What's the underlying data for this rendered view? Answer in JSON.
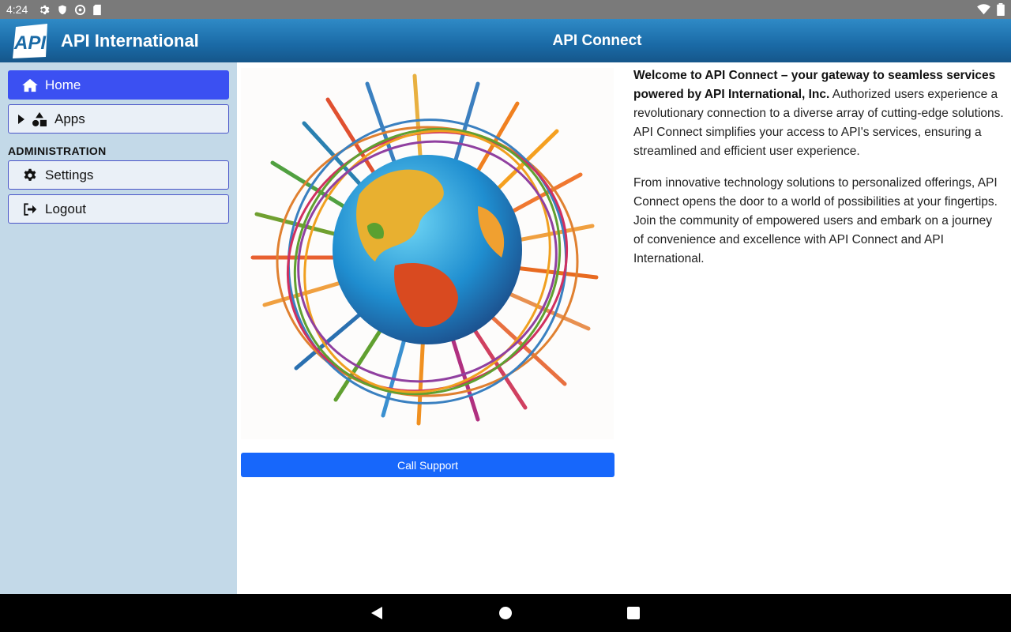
{
  "status_bar": {
    "time": "4:24",
    "left_icons": [
      "gear-icon",
      "shield-icon",
      "sync-icon",
      "sd-card-icon"
    ],
    "right_icons": [
      "wifi-icon",
      "battery-icon"
    ]
  },
  "header": {
    "logo_text": "API",
    "brand": "API International",
    "title": "API Connect",
    "gradient_colors": [
      "#2f8ac6",
      "#15568a"
    ]
  },
  "sidebar": {
    "items": [
      {
        "label": "Home",
        "icon": "home-icon",
        "active": true
      },
      {
        "label": "Apps",
        "icon": "shapes-icon",
        "expandable": true
      }
    ],
    "section_label": "ADMINISTRATION",
    "admin_items": [
      {
        "label": "Settings",
        "icon": "gear-icon"
      },
      {
        "label": "Logout",
        "icon": "logout-icon"
      }
    ],
    "active_color": "#3b50f2",
    "background": "#c3d9e8"
  },
  "main": {
    "illustration": "globe-cables-illustration",
    "call_support_label": "Call Support",
    "call_support_color": "#1767fb",
    "intro_bold": "Welcome to API Connect – your gateway to seamless services powered by API International, Inc.",
    "intro_rest": " Authorized users experience a revolutionary connection to a diverse array of cutting-edge solutions. API Connect simplifies your access to API's services, ensuring a streamlined and efficient user experience.",
    "paragraph2": "From innovative technology solutions to personalized offerings, API Connect opens the door to a world of possibilities at your fingertips. Join the community of empowered users and embark on a journey of convenience and excellence with API Connect and API International."
  },
  "nav_bar": {
    "buttons": [
      "back-icon",
      "home-circle-icon",
      "recents-icon"
    ]
  }
}
